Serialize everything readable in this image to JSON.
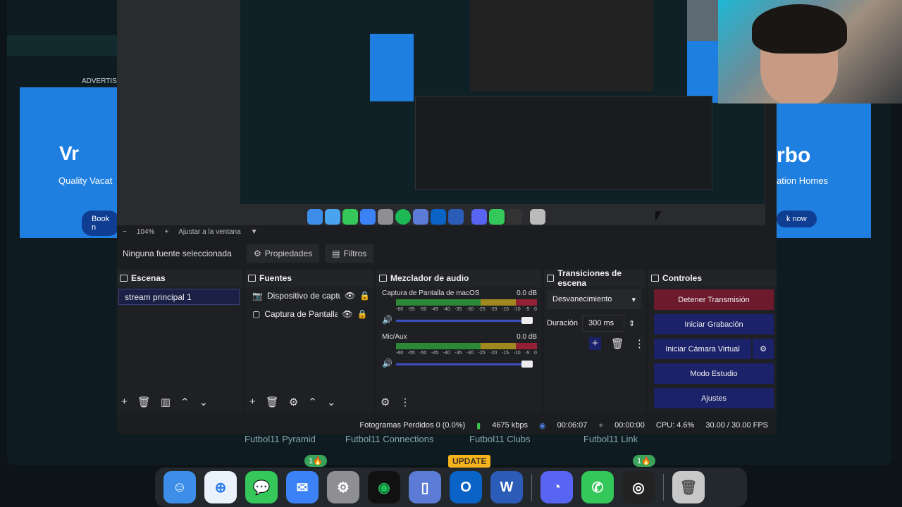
{
  "background_site": {
    "ad_label": "ADVERTIS",
    "ad_left_tagline": "Quality Vacat",
    "ad_left_button": "Book n",
    "ad_left_logo": "Vr",
    "ad_right_logo": "rbo",
    "ad_right_tagline": "ation Homes",
    "ad_right_button": "k now",
    "bottom_links": [
      "Futbol11 Pyramid",
      "Futbol11 Connections",
      "Futbol11 Clubs",
      "Futbol11 Link"
    ],
    "update_badge": "UPDATE",
    "fire_badge": "1🔥"
  },
  "preview": {
    "zoom": "104%",
    "fit_label": "Ajustar a la ventana"
  },
  "source_bar": {
    "no_source": "Ninguna fuente seleccionada",
    "properties": "Propiedades",
    "filters": "Filtros"
  },
  "scenes": {
    "title": "Escenas",
    "items": [
      "stream principal 1"
    ]
  },
  "sources": {
    "title": "Fuentes",
    "items": [
      "Dispositivo de captura",
      "Captura de Pantalla d"
    ]
  },
  "mixer": {
    "title": "Mezclador de audio",
    "channels": [
      {
        "name": "Captura de Pantalla de macOS",
        "level": "0.0 dB"
      },
      {
        "name": "Mic/Aux",
        "level": "0.0 dB"
      }
    ],
    "ticks": [
      "-60",
      "-55",
      "-50",
      "-45",
      "-40",
      "-35",
      "-30",
      "-25",
      "-20",
      "-15",
      "-10",
      "-5",
      "0"
    ]
  },
  "transitions": {
    "title": "Transiciones de escena",
    "selected": "Desvanecimiento",
    "duration_label": "Duración",
    "duration_value": "300 ms"
  },
  "controls": {
    "title": "Controles",
    "stop_stream": "Detener Transmisión",
    "start_recording": "Iniciar Grabación",
    "start_virtual_cam": "Iniciar Cámara Virtual",
    "studio_mode": "Modo Estudio",
    "settings": "Ajustes"
  },
  "status": {
    "dropped_frames": "Fotogramas Perdidos 0 (0.0%)",
    "bitrate": "4675 kbps",
    "stream_time": "00:06:07",
    "record_time": "00:00:00",
    "cpu": "CPU: 4.6%",
    "fps": "30.00 / 30.00 FPS"
  },
  "dock_apps": [
    "finder-icon",
    "safari-icon",
    "messages-icon",
    "mail-icon",
    "settings-icon",
    "spotify-icon",
    "notes-icon",
    "outlook-icon",
    "word-icon",
    "discord-icon",
    "phone-icon",
    "obs-icon",
    "trash-icon"
  ],
  "colors": {
    "stop_button": "#6c1a2c",
    "control_button": "#1b2269",
    "ad_blue": "#1f7fe0",
    "update_yellow": "#f5b41c"
  }
}
